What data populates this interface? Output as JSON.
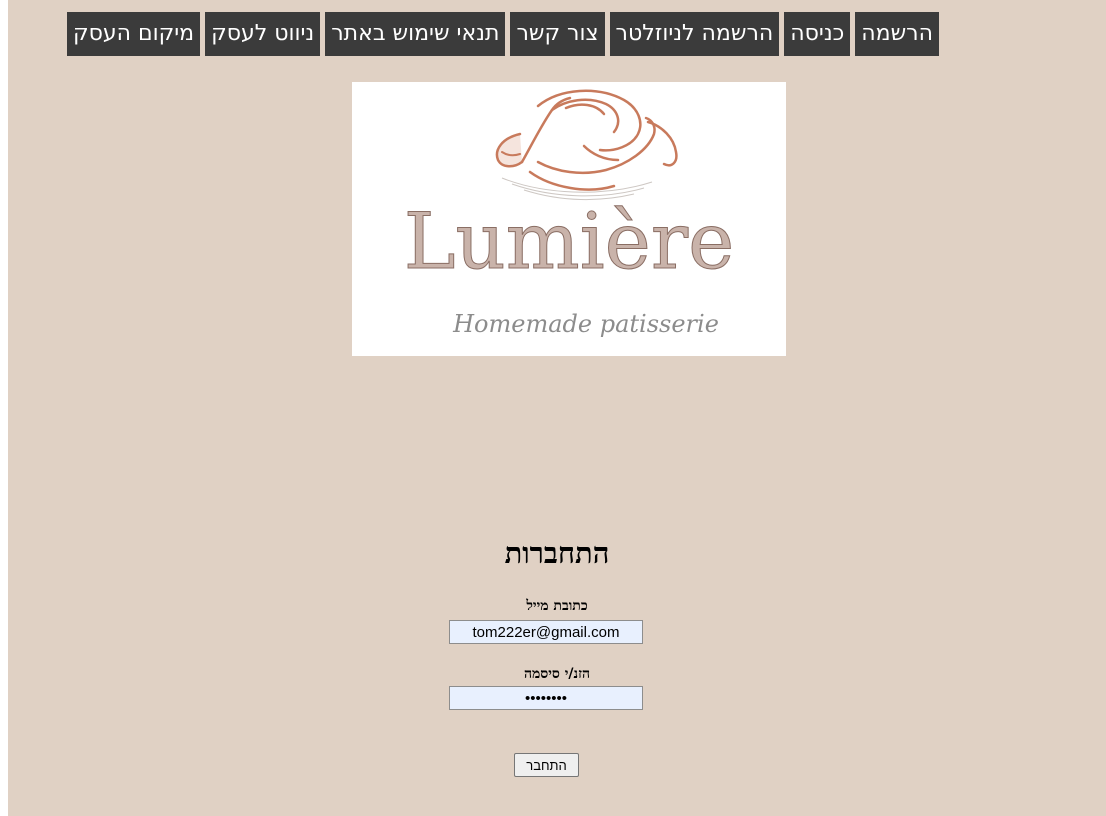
{
  "nav": {
    "items": [
      {
        "id": "business-location",
        "label": "מיקום העסק"
      },
      {
        "id": "business-navigation",
        "label": "ניווט לעסק"
      },
      {
        "id": "terms-of-use",
        "label": "תנאי שימוש באתר"
      },
      {
        "id": "contact",
        "label": "צור קשר"
      },
      {
        "id": "newsletter-signup",
        "label": "הרשמה לניוזלטר"
      },
      {
        "id": "login",
        "label": "כניסה"
      },
      {
        "id": "register",
        "label": "הרשמה"
      }
    ]
  },
  "logo": {
    "brand": "Lumière",
    "tagline": "Homemade patisserie"
  },
  "login": {
    "title": "התחברות",
    "email_label": "כתובת מייל",
    "email_value": "tom222er@gmail.com",
    "password_label": "הזנ/י סיסמה",
    "password_value": "12345678",
    "submit_label": "התחבר"
  }
}
